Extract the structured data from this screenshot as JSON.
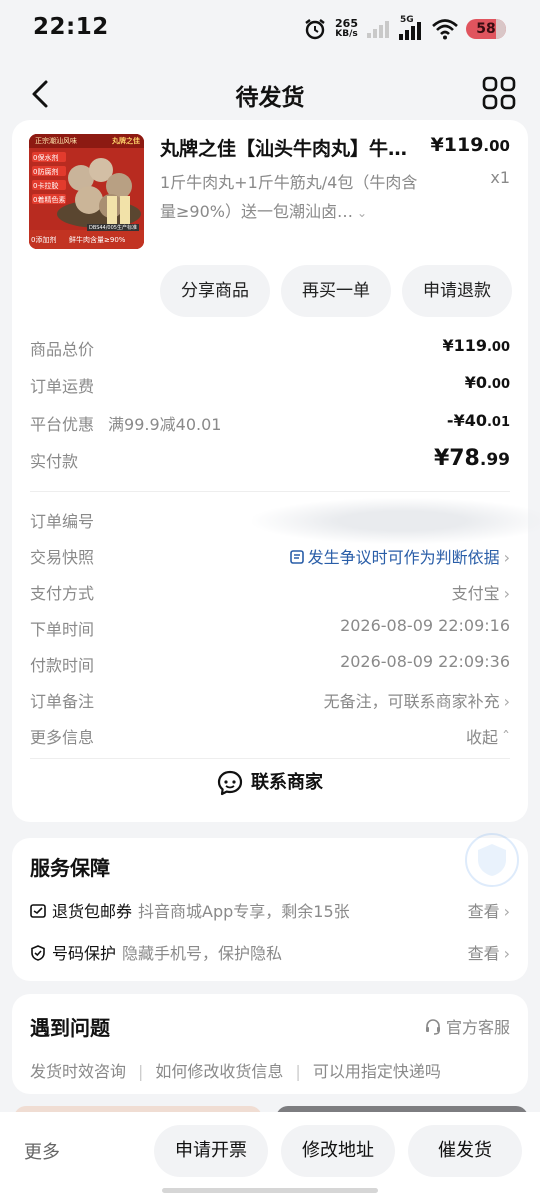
{
  "status_bar": {
    "time": "22:12",
    "speed_value": "265",
    "speed_unit": "KB/s",
    "network": "5G",
    "battery": "58"
  },
  "nav": {
    "title": "待发货"
  },
  "product": {
    "title": "丸牌之佳【汕头牛肉丸】牛…",
    "price_int": "¥119",
    "price_dec": ".00",
    "spec": "1斤牛肉丸+1斤牛筋丸/4包（牛肉含量≥90%）送一包潮汕卤…",
    "qty": "x1",
    "thumb": {
      "badge_top": "正宗潮汕风味",
      "brand": "丸牌之佳",
      "tags": [
        "0保水剂",
        "0防腐剂",
        "0卡拉胶",
        "0着精色素"
      ],
      "code": "DBS44/005生产标准",
      "bottom_left": "0添加剂",
      "bottom_right": "鲜牛肉含量≥90%"
    }
  },
  "actions": {
    "share": "分享商品",
    "rebuy": "再买一单",
    "refund": "申请退款"
  },
  "costs": {
    "total_label": "商品总价",
    "total_int": "¥119",
    "total_dec": ".00",
    "shipping_label": "订单运费",
    "shipping_int": "¥0",
    "shipping_dec": ".00",
    "discount_label": "平台优惠",
    "discount_desc": "满99.9减40.01",
    "discount_int": "-¥40",
    "discount_dec": ".01",
    "paid_label": "实付款",
    "paid_int": "¥78",
    "paid_dec": ".99"
  },
  "info": {
    "order_no_label": "订单编号",
    "snapshot_label": "交易快照",
    "snapshot_value": "发生争议时可作为判断依据",
    "payment_label": "支付方式",
    "payment_value": "支付宝",
    "order_time_label": "下单时间",
    "order_time_value": "2026-08-09 22:09:16",
    "pay_time_label": "付款时间",
    "pay_time_value": "2026-08-09 22:09:36",
    "remark_label": "订单备注",
    "remark_value": "无备注，可联系商家补充",
    "more_label": "更多信息",
    "more_value": "收起"
  },
  "contact": {
    "label": "联系商家"
  },
  "service": {
    "title": "服务保障",
    "items": [
      {
        "name": "退货包邮券",
        "desc": "抖音商城App专享，剩余15张",
        "action": "查看"
      },
      {
        "name": "号码保护",
        "desc": "隐藏手机号，保护隐私",
        "action": "查看"
      }
    ]
  },
  "problems": {
    "title": "遇到问题",
    "service_link": "官方客服",
    "links": [
      "发货时效咨询",
      "如何修改收货信息",
      "可以用指定快递吗"
    ]
  },
  "bottom": {
    "more": "更多",
    "invoice": "申请开票",
    "address": "修改地址",
    "urge": "催发货"
  },
  "colors": {
    "page_bg": "#f3f4f6",
    "card_bg": "#ffffff",
    "pill_bg": "#f2f3f5",
    "muted_text": "#8a8a8a",
    "link_blue": "#2a5ea8",
    "battery_red": "#e0545e"
  }
}
